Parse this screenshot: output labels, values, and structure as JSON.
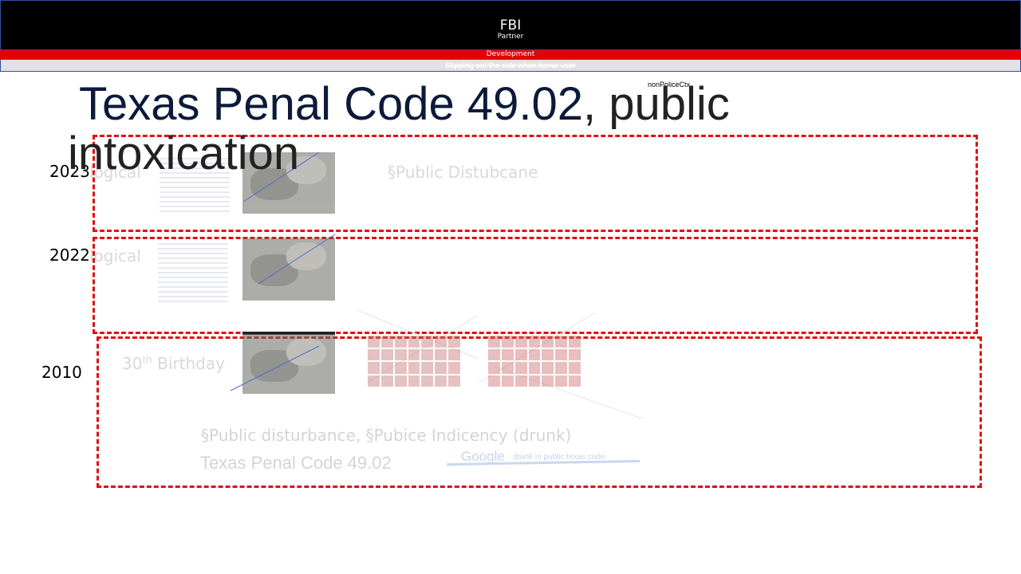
{
  "header": {
    "brand": "FBI",
    "brand_sub": "Partner",
    "dev_label": "Development",
    "notice": "Slipping out the side when honor user"
  },
  "context_tag": "nonPoliceCtx",
  "title": {
    "main": "Texas Penal Code 49.02",
    "rest": ", public intoxication"
  },
  "entries": [
    {
      "year": "2023",
      "tag": "logical",
      "note": "§Public Distubcane"
    },
    {
      "year": "2022",
      "tag": "logical"
    },
    {
      "year": "2010",
      "tag": "30",
      "tag_sup": "th",
      "tag_rest": " Birthday"
    }
  ],
  "footer_notes": {
    "line1": "§Public disturbance, §Pubice Indicency (drunk)",
    "line2": "Texas Penal Code 49.02",
    "search_logo": "Google",
    "search_query": "drunk in public texas code"
  },
  "colors": {
    "accent_red": "#e01010",
    "header_bg": "#000000",
    "dev_bar": "#e60000"
  }
}
